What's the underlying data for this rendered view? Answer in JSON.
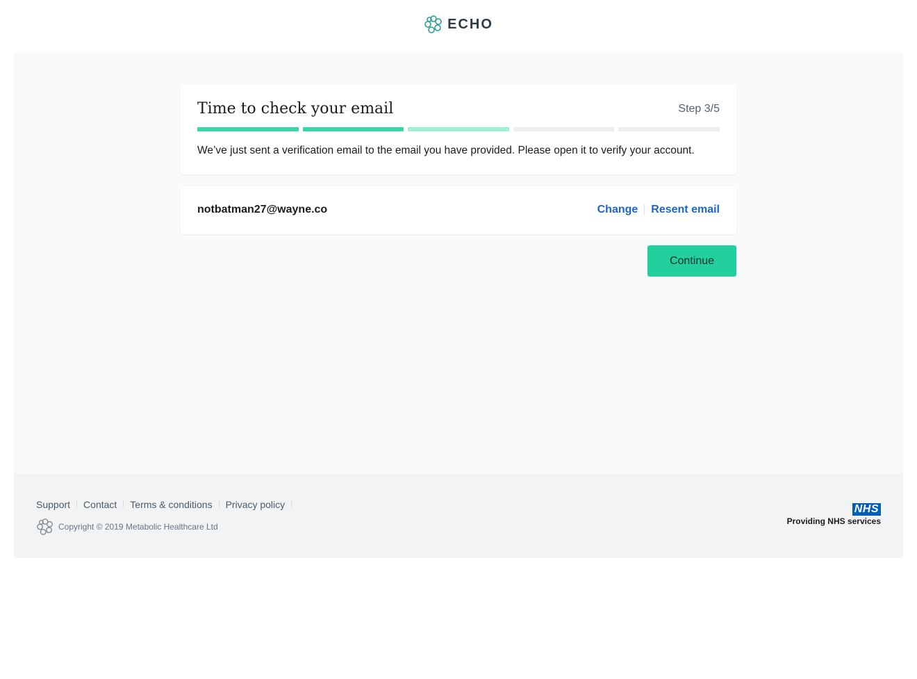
{
  "brand": {
    "name": "ECHO",
    "color": "#2a9d8f"
  },
  "card": {
    "title": "Time to check your email",
    "step": "Step 3/5",
    "description": "We’ve just sent a verification email to the email you have provided. Please open it to verify your account.",
    "progress_colors": [
      "#37d6a5",
      "#37d6a5",
      "#9ceed5",
      "#eceeef",
      "#eceeef"
    ]
  },
  "email_card": {
    "email": "notbatman27@wayne.co",
    "change_label": "Change",
    "resend_label": "Resent email"
  },
  "continue_label": "Continue",
  "footer": {
    "links": [
      "Support",
      "Contact",
      "Terms & conditions",
      "Privacy policy"
    ],
    "copyright": "Copyright © 2019 Metabolic Healthcare Ltd",
    "nhs_badge": "NHS",
    "nhs_text": "Providing NHS services"
  }
}
